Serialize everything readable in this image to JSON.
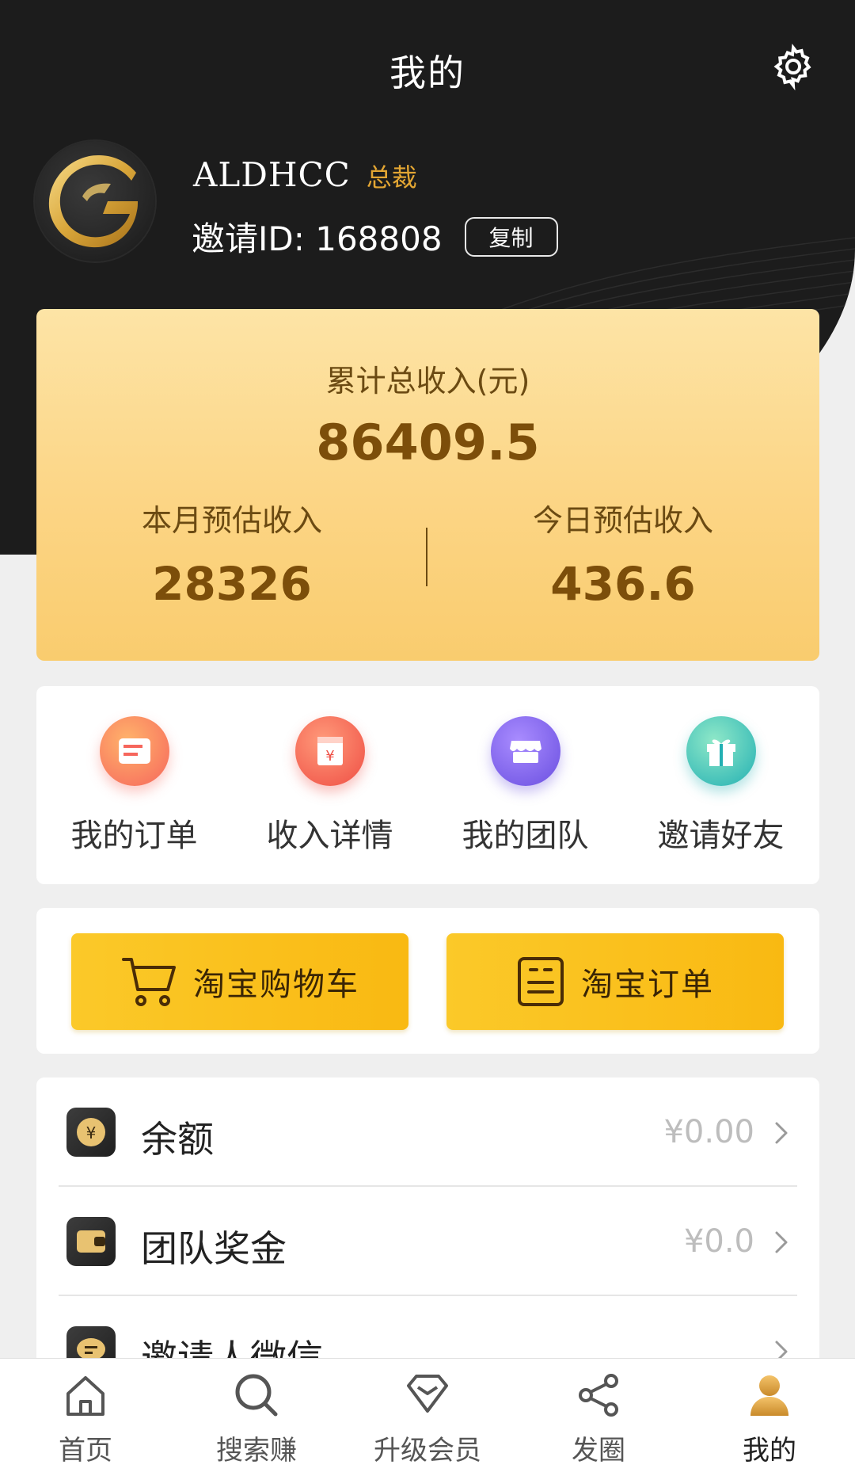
{
  "header": {
    "title": "我的",
    "settings_icon": "gear-icon"
  },
  "profile": {
    "name": "ALDHCC",
    "level": "总裁",
    "invite_label": "邀请ID: 168808",
    "copy_label": "复制",
    "avatar_icon": "g-logo-icon"
  },
  "income": {
    "total_label": "累计总收入(元)",
    "total_value": "86409.5",
    "month_label": "本月预估收入",
    "month_value": "28326",
    "today_label": "今日预估收入",
    "today_value": "436.6"
  },
  "quick_actions": [
    {
      "label": "我的订单",
      "icon": "order-card-icon",
      "color": "#f87a6a"
    },
    {
      "label": "收入详情",
      "icon": "yuan-bill-icon",
      "color": "#f45b4f"
    },
    {
      "label": "我的团队",
      "icon": "store-icon",
      "color": "#7b62e6"
    },
    {
      "label": "邀请好友",
      "icon": "gift-icon",
      "color": "#3bc6b7"
    }
  ],
  "taobao": {
    "cart_label": "淘宝购物车",
    "order_label": "淘宝订单"
  },
  "list": [
    {
      "label": "余额",
      "value": "¥0.00",
      "icon": "coin-icon"
    },
    {
      "label": "团队奖金",
      "value": "¥0.0",
      "icon": "wallet-icon"
    },
    {
      "label": "邀请人微信",
      "value": "",
      "icon": "chat-icon"
    }
  ],
  "tabbar": [
    {
      "label": "首页",
      "icon": "home-icon"
    },
    {
      "label": "搜索赚",
      "icon": "search-icon"
    },
    {
      "label": "升级会员",
      "icon": "diamond-icon"
    },
    {
      "label": "发圈",
      "icon": "share-icon"
    },
    {
      "label": "我的",
      "icon": "user-icon",
      "active": true
    }
  ],
  "colors": {
    "dark_bg": "#1c1c1c",
    "gold_accent": "#e3a633",
    "card_gold": "#fcd585",
    "button_yellow": "#fbc929"
  }
}
